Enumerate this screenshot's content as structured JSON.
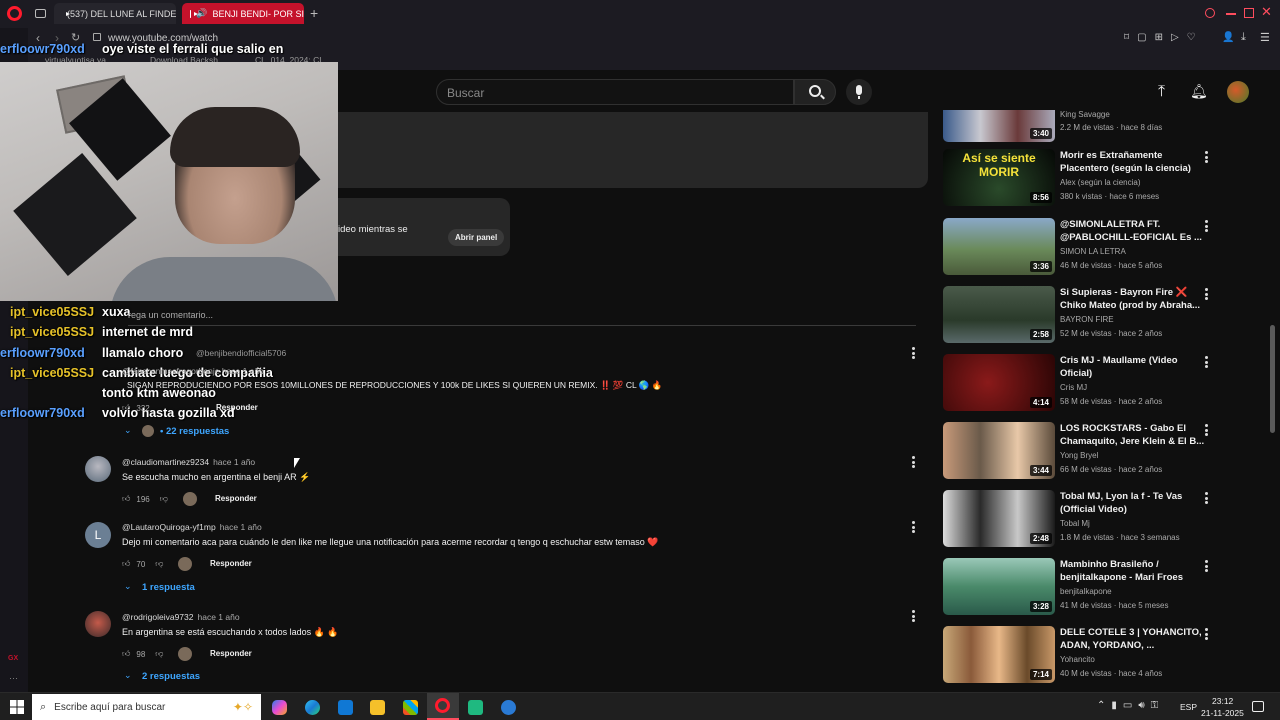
{
  "browser": {
    "tabs": [
      {
        "label": "(537) DEL LUNE AL FINDE",
        "active": false
      },
      {
        "label": "BENJI BENDI- POR SI",
        "active": true
      }
    ],
    "url": "www.youtube.com/watch",
    "bookmarks": [
      "virtualyuotisa.ya",
      "Download Backsh",
      "CL_014_2024: CL"
    ]
  },
  "youtube": {
    "search_placeholder": "Buscar",
    "panel_text": "ideo mientras se",
    "open_panel": "Abrir panel",
    "add_comment": "rega un comentario..."
  },
  "chat": [
    {
      "user": "erfloowr790xd",
      "msg": "oye viste el ferrali que salio en",
      "user_color": "#5aa0ff"
    },
    {
      "user": "ipt_vice05SSJ",
      "msg": "xuxa",
      "user_color": "#e6c229"
    },
    {
      "user": "ipt_vice05SSJ",
      "msg": "internet de mrd",
      "user_color": "#e6c229"
    },
    {
      "user": "erfloowr790xd",
      "msg": "llamalo choro",
      "user_color": "#5aa0ff"
    },
    {
      "user": "ipt_vice05SSJ",
      "msg": "cambiate luego de compañia",
      "user_color": "#e6c229"
    },
    {
      "user": "",
      "msg": "tonto ktm aweonao",
      "user_color": "#e6c229"
    },
    {
      "user": "erfloowr790xd",
      "msg": "volvio hasta gozilla xd",
      "user_color": "#5aa0ff"
    }
  ],
  "comments": {
    "pinned_author": "@benjibendiofficial5706",
    "pinned_author2": "@fansconmasfragorbenje hace 1 año",
    "pinned_text": "SIGAN REPRODUCIENDO POR ESOS 10MILLONES DE REPRODUCCIONES Y 100k DE LIKES SI QUIEREN UN REMIX. ‼️ 💯 CL 🌎 🔥",
    "pinned_likes": "332",
    "pinned_reply": "Responder",
    "pinned_replies": "• 22 respuestas",
    "items": [
      {
        "author": "@claudiomartinez9234",
        "time": "hace 1 año",
        "text": "Se escucha mucho en argentina el benji AR ⚡",
        "likes": "196",
        "reply": "Responder",
        "replies": ""
      },
      {
        "author": "@LautaroQuiroga-yf1mp",
        "time": "hace 1 año",
        "text": "Dejo mi comentario aca para cuándo le den like me llegue una notificación para acerme recordar q tengo q eschuchar estw temaso ❤️",
        "likes": "70",
        "reply": "Responder",
        "replies": "1 respuesta",
        "avatar_letter": "L"
      },
      {
        "author": "@rodrigoleiva9732",
        "time": "hace 1 año",
        "text": "En argentina se está escuchando x todos lados 🔥 🔥",
        "likes": "98",
        "reply": "Responder",
        "replies": "2 respuestas"
      }
    ]
  },
  "recommendations": [
    {
      "title": "",
      "channel": "King Savagge",
      "meta": "2.2 M de vistas · hace 8 días",
      "duration": "3:40"
    },
    {
      "title": "Morir es Extrañamente Placentero (según la ciencia)",
      "channel": "Alex (según la ciencia)",
      "meta": "380 k vistas · hace 6 meses",
      "duration": "8:56",
      "thumb_text": "Así se siente MORIR"
    },
    {
      "title": "@SIMONLALETRA FT. @PABLOCHILL-EOFICIAL  Es ...",
      "channel": "SIMON LA LETRA",
      "meta": "46 M de vistas · hace 5 años",
      "duration": "3:36"
    },
    {
      "title": "Si Supieras - Bayron Fire ❌ Chiko Mateo (prod by Abraha...",
      "channel": "BAYRON FIRE",
      "meta": "52 M de vistas · hace 2 años",
      "duration": "2:58"
    },
    {
      "title": "Cris MJ - Maullame (Video Oficial)",
      "channel": "Cris MJ",
      "meta": "58 M de vistas · hace 2 años",
      "duration": "4:14"
    },
    {
      "title": "LOS ROCKSTARS - Gabo El Chamaquito, Jere Klein & El B...",
      "channel": "Yong Bryel",
      "meta": "66 M de vistas · hace 2 años",
      "duration": "3:44"
    },
    {
      "title": "Tobal MJ, Lyon la f - Te Vas (Official Video)",
      "channel": "Tobal Mj",
      "meta": "1.8 M de vistas · hace 3 semanas",
      "duration": "2:48"
    },
    {
      "title": "Mambinho Brasileño / benjitalkapone - Mari Froes",
      "channel": "benjitalkapone",
      "meta": "41 M de vistas · hace 5 meses",
      "duration": "3:28"
    },
    {
      "title": "DELE COTELE 3 | YOHANCITO, ADAN, YORDANO, ...",
      "channel": "Yohancito",
      "meta": "40 M de vistas · hace 4 años",
      "duration": "7:14"
    }
  ],
  "taskbar": {
    "search_placeholder": "Escribe aquí para buscar",
    "lang": "ESP",
    "time": "23:12",
    "date": "21-11-2025"
  },
  "colors": {
    "accent_blue": "#3ea6ff",
    "opera_red": "#ff1b2d",
    "active_tab": "#c4122b"
  }
}
